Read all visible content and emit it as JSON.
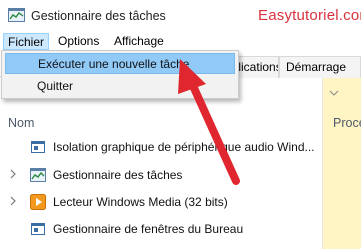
{
  "window": {
    "title": "Gestionnaire des tâches",
    "watermark": "Easytutoriel.com",
    "icon": "task-manager-icon"
  },
  "menubar": {
    "items": [
      "Fichier",
      "Options",
      "Affichage"
    ],
    "open_menu": "Fichier"
  },
  "dropdown": {
    "items": [
      "Exécuter une nouvelle tâche",
      "Quitter"
    ],
    "highlighted": "Exécuter une nouvelle tâche"
  },
  "tabs": {
    "items": [
      "Applications",
      "Démarrage"
    ]
  },
  "columns": {
    "name": "Nom",
    "processor": "Proce"
  },
  "processes": [
    {
      "label": "Isolation graphique de périphérique audio Wind...",
      "icon": "service-icon",
      "expandable": false
    },
    {
      "label": "Gestionnaire des tâches",
      "icon": "task-manager-icon",
      "expandable": true
    },
    {
      "label": "Lecteur Windows Media (32 bits)",
      "icon": "media-player-icon",
      "expandable": true
    },
    {
      "label": "Gestionnaire de fenêtres du Bureau",
      "icon": "service-icon",
      "expandable": false
    }
  ],
  "annotation": {
    "type": "red-arrow",
    "color": "#e0262e",
    "points_to": "Exécuter une nouvelle tâche"
  }
}
